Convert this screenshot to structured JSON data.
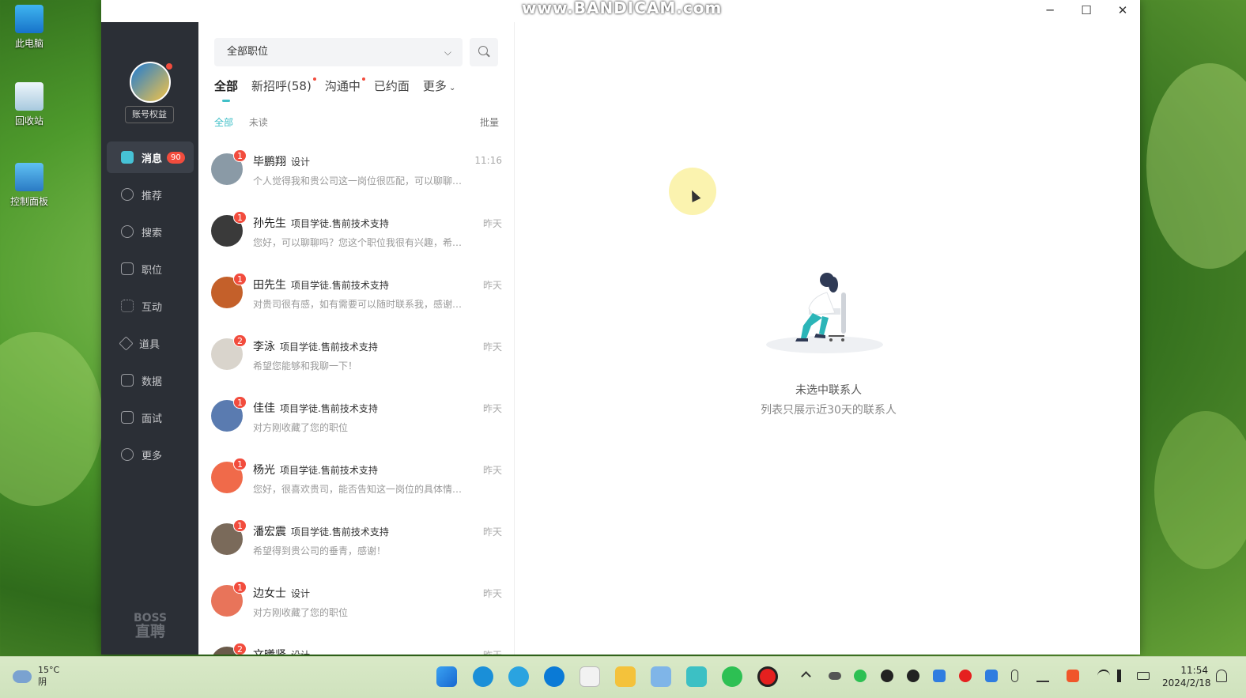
{
  "desktop": {
    "icons": [
      {
        "label": "此电脑"
      },
      {
        "label": "回收站"
      },
      {
        "label": "控制面板"
      }
    ]
  },
  "window": {
    "watermark": "www.BANDICAM.com",
    "controls": {
      "minimize": "─",
      "maximize": "☐",
      "close": "✕"
    }
  },
  "sidebar": {
    "account_button": "账号权益",
    "items": [
      {
        "label": "消息",
        "badge": "90"
      },
      {
        "label": "推荐"
      },
      {
        "label": "搜索"
      },
      {
        "label": "职位"
      },
      {
        "label": "互动"
      },
      {
        "label": "道具"
      },
      {
        "label": "数据"
      },
      {
        "label": "面试"
      },
      {
        "label": "更多"
      }
    ],
    "logo_line1": "BOSS",
    "logo_line2": "直聘"
  },
  "list": {
    "job_select": "全部职位",
    "tabs": [
      {
        "label": "全部"
      },
      {
        "label": "新招呼(58)"
      },
      {
        "label": "沟通中"
      },
      {
        "label": "已约面"
      },
      {
        "label": "更多"
      }
    ],
    "subtabs": {
      "all": "全部",
      "unread": "未读",
      "batch": "批量"
    },
    "conversations": [
      {
        "name": "毕鹏翔",
        "position": "设计",
        "time": "11:16",
        "count": "1",
        "message": "个人觉得我和贵公司这一岗位很匹配，可以聊聊吗？",
        "avatar_color": "#8a9aa6"
      },
      {
        "name": "孙先生",
        "position": "项目学徒.售前技术支持",
        "time": "昨天",
        "count": "1",
        "message": "您好，可以聊聊吗？您这个职位我很有兴趣，希望能进一步了解",
        "avatar_color": "#3a3a3a"
      },
      {
        "name": "田先生",
        "position": "项目学徒.售前技术支持",
        "time": "昨天",
        "count": "1",
        "message": "对贵司很有感，如有需要可以随时联系我，感谢您的关注",
        "avatar_color": "#c4602a"
      },
      {
        "name": "李泳",
        "position": "项目学徒.售前技术支持",
        "time": "昨天",
        "count": "2",
        "message": "希望您能够和我聊一下！",
        "avatar_color": "#d9d4cc"
      },
      {
        "name": "佳佳",
        "position": "项目学徒.售前技术支持",
        "time": "昨天",
        "count": "1",
        "message": "对方刚收藏了您的职位",
        "avatar_color": "#5a7bb0"
      },
      {
        "name": "杨光",
        "position": "项目学徒.售前技术支持",
        "time": "昨天",
        "count": "1",
        "message": "您好，很喜欢贵司，能否告知这一岗位的具体情况？",
        "avatar_color": "#f06a4a"
      },
      {
        "name": "潘宏震",
        "position": "项目学徒.售前技术支持",
        "time": "昨天",
        "count": "1",
        "message": "希望得到贵公司的垂青，感谢！",
        "avatar_color": "#7a6a5a"
      },
      {
        "name": "边女士",
        "position": "设计",
        "time": "昨天",
        "count": "1",
        "message": "对方刚收藏了您的职位",
        "avatar_color": "#e8745a"
      },
      {
        "name": "文曦贤",
        "position": "设计",
        "time": "昨天",
        "count": "2",
        "message": "",
        "avatar_color": "#6a5a4a"
      }
    ]
  },
  "empty_state": {
    "title": "未选中联系人",
    "subtitle": "列表只展示近30天的联系人"
  },
  "taskbar": {
    "temperature": "15°C",
    "condition": "阴",
    "time": "11:54",
    "date": "2024/2/18"
  }
}
